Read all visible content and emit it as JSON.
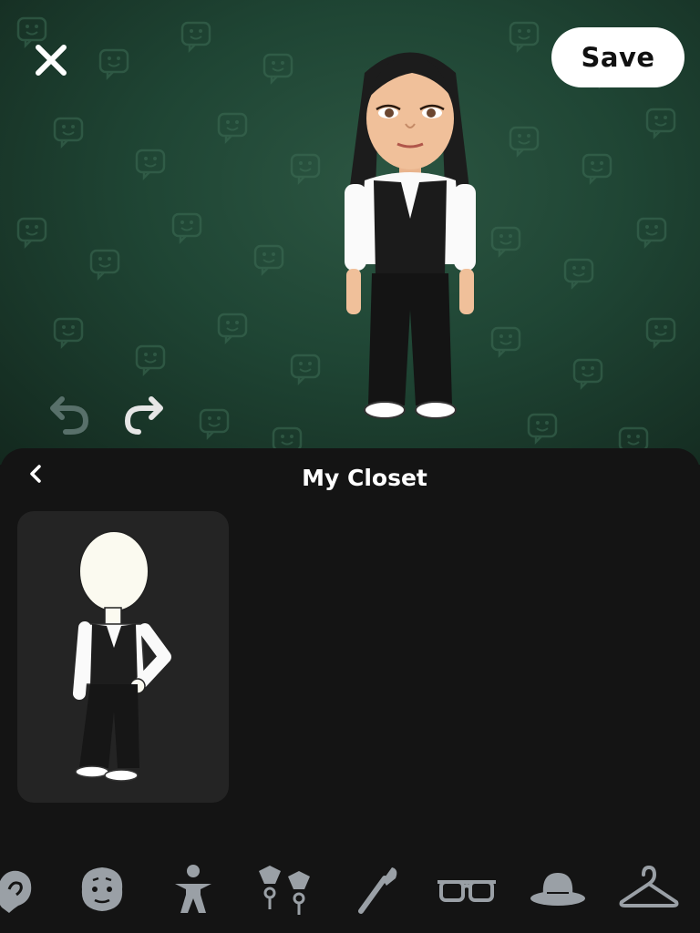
{
  "header": {
    "save_label": "Save",
    "close_icon": "close-icon",
    "undo_icon": "undo-icon",
    "redo_icon": "redo-icon"
  },
  "closet": {
    "title": "My Closet",
    "back_icon": "chevron-left-icon",
    "outfits": [
      {
        "name": "black-vest-outfit"
      }
    ]
  },
  "tabs": [
    {
      "name": "ear-icon"
    },
    {
      "name": "face-icon"
    },
    {
      "name": "body-icon"
    },
    {
      "name": "earrings-icon"
    },
    {
      "name": "makeup-brush-icon"
    },
    {
      "name": "glasses-icon"
    },
    {
      "name": "hat-icon"
    },
    {
      "name": "hanger-icon"
    }
  ],
  "colors": {
    "stage_green": "#1f4534",
    "sheet_bg": "#141414",
    "card_bg": "#242424",
    "icon_gray": "#9aa0a6",
    "save_bg": "#ffffff"
  }
}
